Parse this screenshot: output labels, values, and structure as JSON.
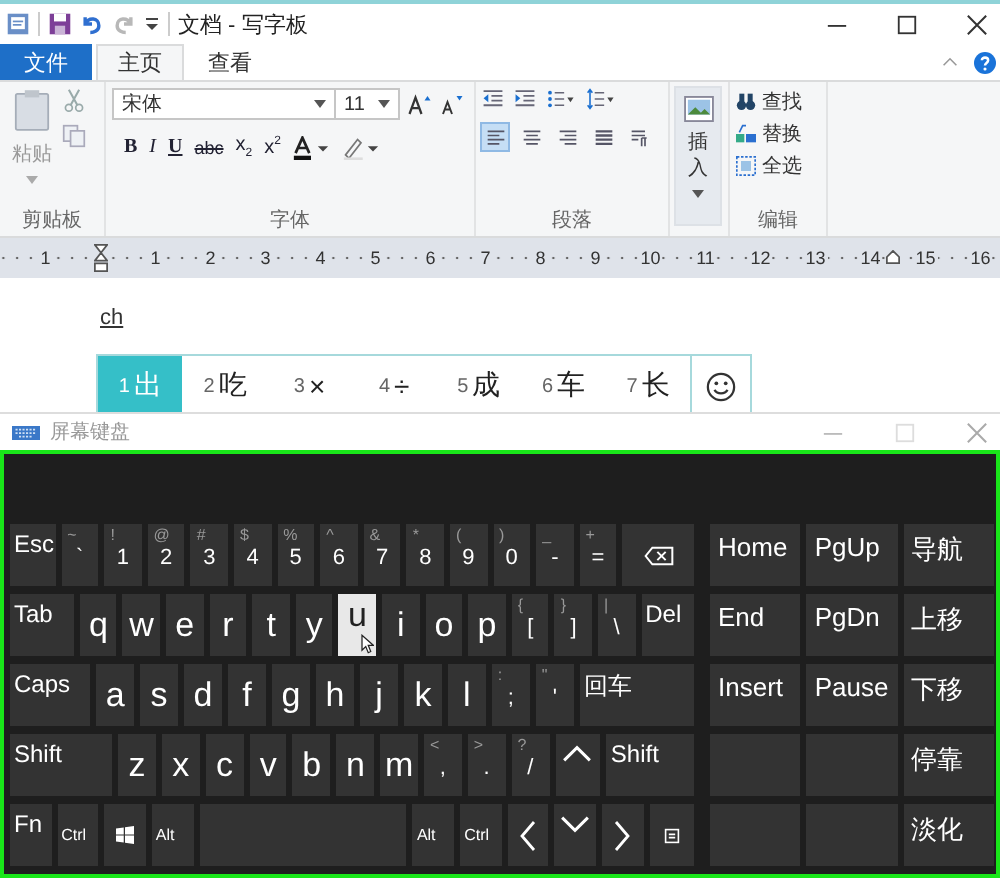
{
  "app_window": {
    "title": "文档 - 写字板"
  },
  "ribbon_tabs": [
    {
      "label": "文件",
      "kind": "file",
      "selected": false
    },
    {
      "label": "主页",
      "kind": "tab",
      "selected": true
    },
    {
      "label": "查看",
      "kind": "tab",
      "selected": false
    }
  ],
  "clipboard": {
    "paste": "粘贴",
    "group": "剪贴板"
  },
  "font": {
    "family": "宋体",
    "size": "11",
    "group": "字体",
    "formats": [
      {
        "kind": "bold",
        "label": "B"
      },
      {
        "kind": "italic",
        "label": "I"
      },
      {
        "kind": "underline",
        "label": "U"
      },
      {
        "kind": "strikethrough",
        "label": "abc"
      },
      {
        "kind": "subscript",
        "label": "x$_{2}$"
      },
      {
        "kind": "superscript",
        "label": "x$^{2}$"
      }
    ]
  },
  "paragraph": {
    "group": "段落",
    "alignments": [
      {
        "kind": "left",
        "selected": true
      },
      {
        "kind": "center",
        "selected": false
      },
      {
        "kind": "right",
        "selected": false
      },
      {
        "kind": "justify",
        "selected": false
      },
      {
        "kind": "paragraph",
        "selected": false
      }
    ]
  },
  "insert": {
    "label": "插入"
  },
  "editing": {
    "group": "编辑",
    "items": [
      {
        "kind": "find",
        "label": "查找"
      },
      {
        "kind": "replace",
        "label": "替换"
      },
      {
        "kind": "select-all",
        "label": "全选"
      }
    ]
  },
  "ruler": {
    "numbers": [
      "1",
      "1",
      "2",
      "3",
      "4",
      "5",
      "6",
      "7",
      "8",
      "9",
      "10",
      "11",
      "12",
      "13",
      "14",
      "15",
      "16"
    ]
  },
  "document": {
    "composition": "ch"
  },
  "ime_candidates": [
    {
      "index": "1",
      "text": "出",
      "selected": true
    },
    {
      "index": "2",
      "text": "吃",
      "selected": false
    },
    {
      "index": "3",
      "text": "×",
      "selected": false
    },
    {
      "index": "4",
      "text": "÷",
      "selected": false
    },
    {
      "index": "5",
      "text": "成",
      "selected": false
    },
    {
      "index": "6",
      "text": "车",
      "selected": false
    },
    {
      "index": "7",
      "text": "长",
      "selected": false
    }
  ],
  "osk": {
    "title": "屏幕键盘",
    "rows": [
      [
        {
          "kind": "mod",
          "label": "Esc",
          "pressed": false
        },
        {
          "kind": "symbol",
          "shift": "~",
          "label": "`",
          "pressed": false
        },
        {
          "kind": "symbol",
          "shift": "!",
          "label": "1",
          "pressed": false
        },
        {
          "kind": "symbol",
          "shift": "@",
          "label": "2",
          "pressed": false
        },
        {
          "kind": "symbol",
          "shift": "#",
          "label": "3",
          "pressed": false
        },
        {
          "kind": "symbol",
          "shift": "$",
          "label": "4",
          "pressed": false
        },
        {
          "kind": "symbol",
          "shift": "%",
          "label": "5",
          "pressed": false
        },
        {
          "kind": "symbol",
          "shift": "^",
          "label": "6",
          "pressed": false
        },
        {
          "kind": "symbol",
          "shift": "&",
          "label": "7",
          "pressed": false
        },
        {
          "kind": "symbol",
          "shift": "*",
          "label": "8",
          "pressed": false
        },
        {
          "kind": "symbol",
          "shift": "(",
          "label": "9",
          "pressed": false
        },
        {
          "kind": "symbol",
          "shift": ")",
          "label": "0",
          "pressed": false
        },
        {
          "kind": "symbol",
          "shift": "_",
          "label": "-",
          "pressed": false
        },
        {
          "kind": "symbol",
          "shift": "+",
          "label": "=",
          "pressed": false
        },
        {
          "kind": "backspace",
          "pressed": false
        }
      ],
      [
        {
          "kind": "mod",
          "label": "Tab",
          "pressed": false
        },
        {
          "kind": "letter",
          "label": "q",
          "pressed": false
        },
        {
          "kind": "letter",
          "label": "w",
          "pressed": false
        },
        {
          "kind": "letter",
          "label": "e",
          "pressed": false
        },
        {
          "kind": "letter",
          "label": "r",
          "pressed": false
        },
        {
          "kind": "letter",
          "label": "t",
          "pressed": false
        },
        {
          "kind": "letter",
          "label": "y",
          "pressed": false
        },
        {
          "kind": "letter",
          "label": "u",
          "pressed": true
        },
        {
          "kind": "letter",
          "label": "i",
          "pressed": false
        },
        {
          "kind": "letter",
          "label": "o",
          "pressed": false
        },
        {
          "kind": "letter",
          "label": "p",
          "pressed": false
        },
        {
          "kind": "symbol",
          "shift": "{",
          "label": "[",
          "pressed": false
        },
        {
          "kind": "symbol",
          "shift": "}",
          "label": "]",
          "pressed": false
        },
        {
          "kind": "symbol",
          "shift": "|",
          "label": "\\",
          "pressed": false
        },
        {
          "kind": "mod",
          "label": "Del",
          "pressed": false
        }
      ],
      [
        {
          "kind": "mod",
          "label": "Caps",
          "pressed": false
        },
        {
          "kind": "letter",
          "label": "a",
          "pressed": false
        },
        {
          "kind": "letter",
          "label": "s",
          "pressed": false
        },
        {
          "kind": "letter",
          "label": "d",
          "pressed": false
        },
        {
          "kind": "letter",
          "label": "f",
          "pressed": false
        },
        {
          "kind": "letter",
          "label": "g",
          "pressed": false
        },
        {
          "kind": "letter",
          "label": "h",
          "pressed": false
        },
        {
          "kind": "letter",
          "label": "j",
          "pressed": false
        },
        {
          "kind": "letter",
          "label": "k",
          "pressed": false
        },
        {
          "kind": "letter",
          "label": "l",
          "pressed": false
        },
        {
          "kind": "symbol",
          "shift": ":",
          "label": ";",
          "pressed": false
        },
        {
          "kind": "symbol",
          "shift": "\"",
          "label": "'",
          "pressed": false
        },
        {
          "kind": "mod",
          "label": "回车",
          "pressed": false
        }
      ],
      [
        {
          "kind": "mod",
          "label": "Shift",
          "pressed": false
        },
        {
          "kind": "letter",
          "label": "z",
          "pressed": false
        },
        {
          "kind": "letter",
          "label": "x",
          "pressed": false
        },
        {
          "kind": "letter",
          "label": "c",
          "pressed": false
        },
        {
          "kind": "letter",
          "label": "v",
          "pressed": false
        },
        {
          "kind": "letter",
          "label": "b",
          "pressed": false
        },
        {
          "kind": "letter",
          "label": "n",
          "pressed": false
        },
        {
          "kind": "letter",
          "label": "m",
          "pressed": false
        },
        {
          "kind": "symbol",
          "shift": "<",
          "label": ",",
          "pressed": false
        },
        {
          "kind": "symbol",
          "shift": ">",
          "label": ".",
          "pressed": false
        },
        {
          "kind": "symbol",
          "shift": "?",
          "label": "/",
          "pressed": false
        },
        {
          "kind": "up",
          "pressed": false
        },
        {
          "kind": "mod",
          "label": "Shift",
          "pressed": false
        }
      ],
      [
        {
          "kind": "mod",
          "label": "Fn",
          "pressed": false
        },
        {
          "kind": "small",
          "label": "Ctrl",
          "pressed": false
        },
        {
          "kind": "windows",
          "pressed": false
        },
        {
          "kind": "small",
          "label": "Alt",
          "pressed": false
        },
        {
          "kind": "space",
          "pressed": false
        },
        {
          "kind": "small",
          "label": "Alt",
          "pressed": false
        },
        {
          "kind": "small",
          "label": "Ctrl",
          "pressed": false
        },
        {
          "kind": "left",
          "pressed": false
        },
        {
          "kind": "down",
          "pressed": false
        },
        {
          "kind": "right",
          "pressed": false
        },
        {
          "kind": "menu",
          "pressed": false
        }
      ]
    ],
    "nav_rows": [
      [
        {
          "kind": "mod",
          "label": "Home",
          "pressed": false
        },
        {
          "kind": "mod",
          "label": "PgUp",
          "pressed": false
        },
        {
          "kind": "mod",
          "label": "导航",
          "pressed": false
        }
      ],
      [
        {
          "kind": "mod",
          "label": "End",
          "pressed": false
        },
        {
          "kind": "mod",
          "label": "PgDn",
          "pressed": false
        },
        {
          "kind": "mod",
          "label": "上移",
          "pressed": false
        }
      ],
      [
        {
          "kind": "mod",
          "label": "Insert",
          "pressed": false
        },
        {
          "kind": "mod",
          "label": "Pause",
          "pressed": false
        },
        {
          "kind": "mod",
          "label": "下移",
          "pressed": false
        }
      ],
      [
        {
          "kind": "blank",
          "pressed": false
        },
        {
          "kind": "blank",
          "pressed": false
        },
        {
          "kind": "mod",
          "label": "停靠",
          "pressed": false
        }
      ],
      [
        {
          "kind": "blank",
          "pressed": false
        },
        {
          "kind": "blank",
          "pressed": false
        },
        {
          "kind": "mod",
          "label": "淡化",
          "pressed": false
        }
      ]
    ]
  }
}
